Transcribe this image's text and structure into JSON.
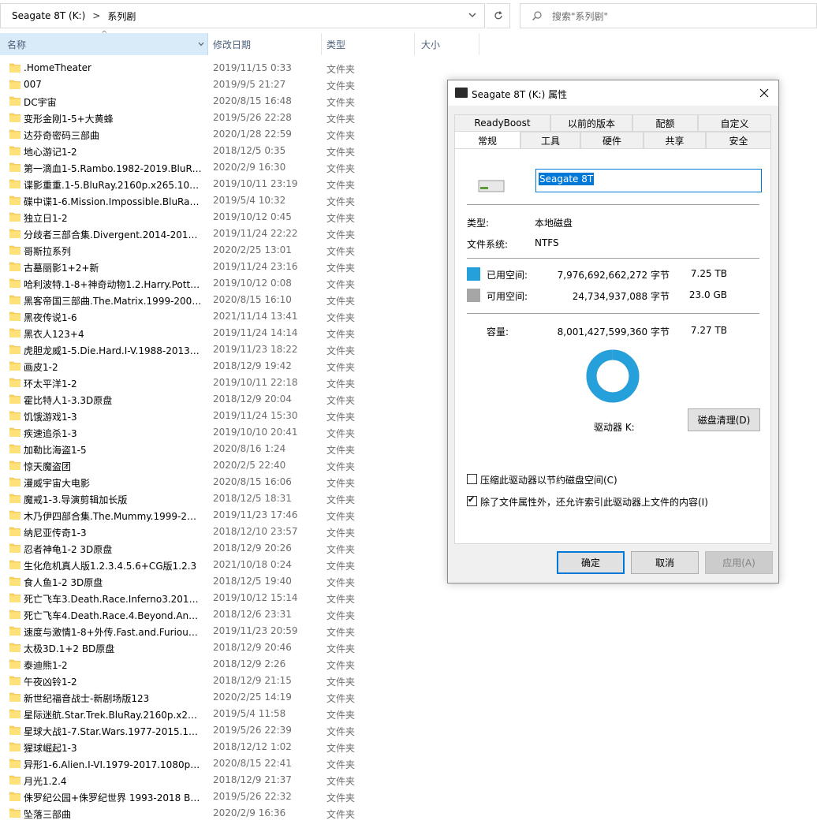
{
  "addressbar": {
    "drive": "Seagate 8T (K:)",
    "separator": ">",
    "folder": "系列剧"
  },
  "search": {
    "placeholder": "搜索\"系列剧\""
  },
  "columns": {
    "name": "名称",
    "date": "修改日期",
    "type": "类型",
    "size": "大小"
  },
  "files": [
    {
      "name": ".HomeTheater",
      "date": "2019/11/15 0:33",
      "type": "文件夹"
    },
    {
      "name": "007",
      "date": "2019/9/5 21:27",
      "type": "文件夹"
    },
    {
      "name": "DC宇宙",
      "date": "2020/8/15 16:48",
      "type": "文件夹"
    },
    {
      "name": "变形金刚1-5+大黄蜂",
      "date": "2019/5/26 22:28",
      "type": "文件夹"
    },
    {
      "name": "达芬奇密码三部曲",
      "date": "2020/1/28 22:59",
      "type": "文件夹"
    },
    {
      "name": "地心游记1-2",
      "date": "2018/12/5 0:35",
      "type": "文件夹"
    },
    {
      "name": "第一滴血1-5.Rambo.1982-2019.BluRa...",
      "date": "2020/2/9 16:30",
      "type": "文件夹"
    },
    {
      "name": "谍影重重.1-5.BluRay.2160p.x265.10bit....",
      "date": "2019/10/11 23:19",
      "type": "文件夹"
    },
    {
      "name": "碟中谍1-6.Mission.Impossible.BluRay....",
      "date": "2019/5/4 10:32",
      "type": "文件夹"
    },
    {
      "name": "独立日1-2",
      "date": "2019/10/12 0:45",
      "type": "文件夹"
    },
    {
      "name": "分歧者三部合集.Divergent.2014-2016....",
      "date": "2019/11/24 22:22",
      "type": "文件夹"
    },
    {
      "name": "哥斯拉系列",
      "date": "2020/2/25 13:01",
      "type": "文件夹"
    },
    {
      "name": "古墓丽影1+2+新",
      "date": "2019/11/24 23:16",
      "type": "文件夹"
    },
    {
      "name": "哈利波特.1-8+神奇动物1.2.Harry.Potter....",
      "date": "2019/10/12 0:08",
      "type": "文件夹"
    },
    {
      "name": "黑客帝国三部曲.The.Matrix.1999-2003....",
      "date": "2020/8/15 16:10",
      "type": "文件夹"
    },
    {
      "name": "黑夜传说1-6",
      "date": "2021/11/14 13:41",
      "type": "文件夹"
    },
    {
      "name": "黑衣人123+4",
      "date": "2019/11/24 14:14",
      "type": "文件夹"
    },
    {
      "name": "虎胆龙威1-5.Die.Hard.I-V.1988-2013.B...",
      "date": "2019/11/23 18:22",
      "type": "文件夹"
    },
    {
      "name": "画皮1-2",
      "date": "2018/12/9 19:42",
      "type": "文件夹"
    },
    {
      "name": "环太平洋1-2",
      "date": "2019/10/11 22:18",
      "type": "文件夹"
    },
    {
      "name": "霍比特人1-3.3D原盘",
      "date": "2018/12/9 20:04",
      "type": "文件夹"
    },
    {
      "name": "饥饿游戏1-3",
      "date": "2019/11/24 15:30",
      "type": "文件夹"
    },
    {
      "name": "疾速追杀1-3",
      "date": "2019/10/10 20:41",
      "type": "文件夹"
    },
    {
      "name": "加勒比海盗1-5",
      "date": "2020/8/16 1:24",
      "type": "文件夹"
    },
    {
      "name": "惊天魔盗团",
      "date": "2020/2/5 22:40",
      "type": "文件夹"
    },
    {
      "name": "漫威宇宙大电影",
      "date": "2020/8/15 16:06",
      "type": "文件夹"
    },
    {
      "name": "魔戒1-3.导演剪辑加长版",
      "date": "2018/12/5 18:31",
      "type": "文件夹"
    },
    {
      "name": "木乃伊四部合集.The.Mummy.1999-201...",
      "date": "2019/11/23 17:46",
      "type": "文件夹"
    },
    {
      "name": "纳尼亚传奇1-3",
      "date": "2018/12/10 23:57",
      "type": "文件夹"
    },
    {
      "name": "忍者神龟1-2 3D原盘",
      "date": "2018/12/9 20:26",
      "type": "文件夹"
    },
    {
      "name": "生化危机真人版1.2.3.4.5.6+CG版1.2.3",
      "date": "2021/10/18 0:24",
      "type": "文件夹"
    },
    {
      "name": "食人鱼1-2 3D原盘",
      "date": "2018/12/5 19:40",
      "type": "文件夹"
    },
    {
      "name": "死亡飞车3.Death.Race.Inferno3.2012....",
      "date": "2019/10/12 15:14",
      "type": "文件夹"
    },
    {
      "name": "死亡飞车4.Death.Race.4.Beyond.Anarc...",
      "date": "2018/12/6 23:31",
      "type": "文件夹"
    },
    {
      "name": "速度与激情1-8+外传.Fast.and.Furious....",
      "date": "2019/11/23 20:59",
      "type": "文件夹"
    },
    {
      "name": "太极3D.1+2 BD原盘",
      "date": "2018/12/9 20:46",
      "type": "文件夹"
    },
    {
      "name": "泰迪熊1-2",
      "date": "2018/12/9 2:26",
      "type": "文件夹"
    },
    {
      "name": "午夜凶铃1-2",
      "date": "2018/12/9 21:15",
      "type": "文件夹"
    },
    {
      "name": "新世纪福音战士-新剧场版123",
      "date": "2020/2/25 14:19",
      "type": "文件夹"
    },
    {
      "name": "星际迷航.Star.Trek.BluRay.2160p.x265....",
      "date": "2019/5/4 11:58",
      "type": "文件夹"
    },
    {
      "name": "星球大战1-7.Star.Wars.1977-2015.108...",
      "date": "2019/5/26 22:39",
      "type": "文件夹"
    },
    {
      "name": "猩球崛起1-3",
      "date": "2018/12/12 1:02",
      "type": "文件夹"
    },
    {
      "name": "异形1-6.Alien.I-VI.1979-2017.1080p.Bl...",
      "date": "2020/8/15 22:41",
      "type": "文件夹"
    },
    {
      "name": "月光1.2.4",
      "date": "2018/12/9 21:37",
      "type": "文件夹"
    },
    {
      "name": "侏罗纪公园+侏罗纪世界 1993-2018 Blu...",
      "date": "2019/5/26 22:32",
      "type": "文件夹"
    },
    {
      "name": "坠落三部曲",
      "date": "2020/2/9 16:36",
      "type": "文件夹"
    }
  ],
  "dialog": {
    "title": "Seagate 8T (K:) 属性",
    "tabs_top": [
      "ReadyBoost",
      "以前的版本",
      "配额",
      "自定义"
    ],
    "tabs_bottom": [
      "常规",
      "工具",
      "硬件",
      "共享",
      "安全"
    ],
    "active_tab": "常规",
    "drive_name": "Seagate 8T",
    "type_label": "类型:",
    "type_value": "本地磁盘",
    "fs_label": "文件系统:",
    "fs_value": "NTFS",
    "used_label": "已用空间:",
    "used_bytes": "7,976,692,662,272 字节",
    "used_size": "7.25 TB",
    "free_label": "可用空间:",
    "free_bytes": "24,734,937,088 字节",
    "free_size": "23.0 GB",
    "capacity_label": "容量:",
    "capacity_bytes": "8,001,427,599,360 字节",
    "capacity_size": "7.27 TB",
    "drive_label": "驱动器 K:",
    "used_fraction": 0.9969,
    "used_color": "#26a0da",
    "free_color": "#a6a6a6",
    "cleanup_button": "磁盘清理(D)",
    "compress_label": "压缩此驱动器以节约磁盘空间(C)",
    "compress_checked": false,
    "index_label": "除了文件属性外，还允许索引此驱动器上文件的内容(I)",
    "index_checked": true,
    "ok": "确定",
    "cancel": "取消",
    "apply": "应用(A)"
  }
}
